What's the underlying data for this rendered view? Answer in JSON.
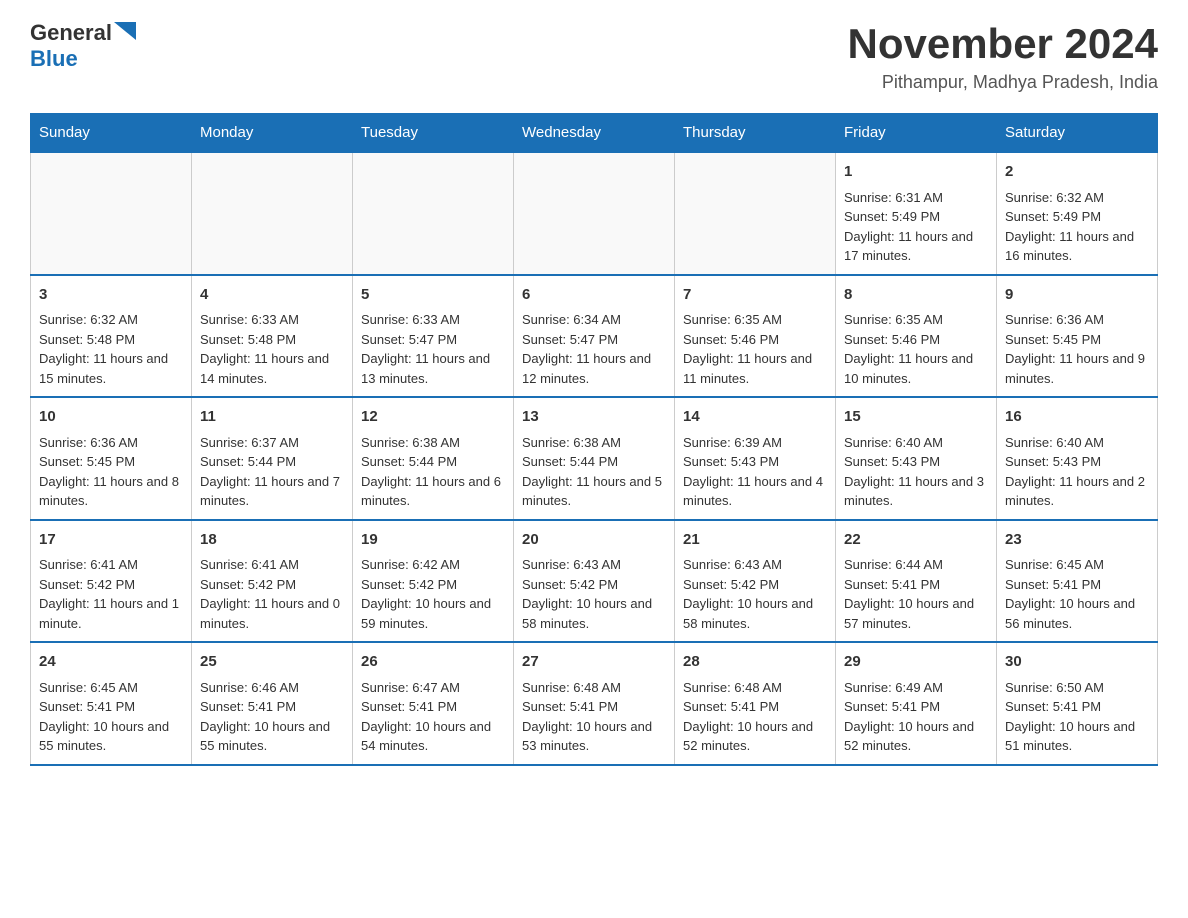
{
  "header": {
    "logo": {
      "general": "General",
      "blue": "Blue"
    },
    "title": "November 2024",
    "location": "Pithampur, Madhya Pradesh, India"
  },
  "days_of_week": [
    "Sunday",
    "Monday",
    "Tuesday",
    "Wednesday",
    "Thursday",
    "Friday",
    "Saturday"
  ],
  "weeks": [
    {
      "days": [
        {
          "number": "",
          "info": ""
        },
        {
          "number": "",
          "info": ""
        },
        {
          "number": "",
          "info": ""
        },
        {
          "number": "",
          "info": ""
        },
        {
          "number": "",
          "info": ""
        },
        {
          "number": "1",
          "info": "Sunrise: 6:31 AM\nSunset: 5:49 PM\nDaylight: 11 hours and 17 minutes."
        },
        {
          "number": "2",
          "info": "Sunrise: 6:32 AM\nSunset: 5:49 PM\nDaylight: 11 hours and 16 minutes."
        }
      ]
    },
    {
      "days": [
        {
          "number": "3",
          "info": "Sunrise: 6:32 AM\nSunset: 5:48 PM\nDaylight: 11 hours and 15 minutes."
        },
        {
          "number": "4",
          "info": "Sunrise: 6:33 AM\nSunset: 5:48 PM\nDaylight: 11 hours and 14 minutes."
        },
        {
          "number": "5",
          "info": "Sunrise: 6:33 AM\nSunset: 5:47 PM\nDaylight: 11 hours and 13 minutes."
        },
        {
          "number": "6",
          "info": "Sunrise: 6:34 AM\nSunset: 5:47 PM\nDaylight: 11 hours and 12 minutes."
        },
        {
          "number": "7",
          "info": "Sunrise: 6:35 AM\nSunset: 5:46 PM\nDaylight: 11 hours and 11 minutes."
        },
        {
          "number": "8",
          "info": "Sunrise: 6:35 AM\nSunset: 5:46 PM\nDaylight: 11 hours and 10 minutes."
        },
        {
          "number": "9",
          "info": "Sunrise: 6:36 AM\nSunset: 5:45 PM\nDaylight: 11 hours and 9 minutes."
        }
      ]
    },
    {
      "days": [
        {
          "number": "10",
          "info": "Sunrise: 6:36 AM\nSunset: 5:45 PM\nDaylight: 11 hours and 8 minutes."
        },
        {
          "number": "11",
          "info": "Sunrise: 6:37 AM\nSunset: 5:44 PM\nDaylight: 11 hours and 7 minutes."
        },
        {
          "number": "12",
          "info": "Sunrise: 6:38 AM\nSunset: 5:44 PM\nDaylight: 11 hours and 6 minutes."
        },
        {
          "number": "13",
          "info": "Sunrise: 6:38 AM\nSunset: 5:44 PM\nDaylight: 11 hours and 5 minutes."
        },
        {
          "number": "14",
          "info": "Sunrise: 6:39 AM\nSunset: 5:43 PM\nDaylight: 11 hours and 4 minutes."
        },
        {
          "number": "15",
          "info": "Sunrise: 6:40 AM\nSunset: 5:43 PM\nDaylight: 11 hours and 3 minutes."
        },
        {
          "number": "16",
          "info": "Sunrise: 6:40 AM\nSunset: 5:43 PM\nDaylight: 11 hours and 2 minutes."
        }
      ]
    },
    {
      "days": [
        {
          "number": "17",
          "info": "Sunrise: 6:41 AM\nSunset: 5:42 PM\nDaylight: 11 hours and 1 minute."
        },
        {
          "number": "18",
          "info": "Sunrise: 6:41 AM\nSunset: 5:42 PM\nDaylight: 11 hours and 0 minutes."
        },
        {
          "number": "19",
          "info": "Sunrise: 6:42 AM\nSunset: 5:42 PM\nDaylight: 10 hours and 59 minutes."
        },
        {
          "number": "20",
          "info": "Sunrise: 6:43 AM\nSunset: 5:42 PM\nDaylight: 10 hours and 58 minutes."
        },
        {
          "number": "21",
          "info": "Sunrise: 6:43 AM\nSunset: 5:42 PM\nDaylight: 10 hours and 58 minutes."
        },
        {
          "number": "22",
          "info": "Sunrise: 6:44 AM\nSunset: 5:41 PM\nDaylight: 10 hours and 57 minutes."
        },
        {
          "number": "23",
          "info": "Sunrise: 6:45 AM\nSunset: 5:41 PM\nDaylight: 10 hours and 56 minutes."
        }
      ]
    },
    {
      "days": [
        {
          "number": "24",
          "info": "Sunrise: 6:45 AM\nSunset: 5:41 PM\nDaylight: 10 hours and 55 minutes."
        },
        {
          "number": "25",
          "info": "Sunrise: 6:46 AM\nSunset: 5:41 PM\nDaylight: 10 hours and 55 minutes."
        },
        {
          "number": "26",
          "info": "Sunrise: 6:47 AM\nSunset: 5:41 PM\nDaylight: 10 hours and 54 minutes."
        },
        {
          "number": "27",
          "info": "Sunrise: 6:48 AM\nSunset: 5:41 PM\nDaylight: 10 hours and 53 minutes."
        },
        {
          "number": "28",
          "info": "Sunrise: 6:48 AM\nSunset: 5:41 PM\nDaylight: 10 hours and 52 minutes."
        },
        {
          "number": "29",
          "info": "Sunrise: 6:49 AM\nSunset: 5:41 PM\nDaylight: 10 hours and 52 minutes."
        },
        {
          "number": "30",
          "info": "Sunrise: 6:50 AM\nSunset: 5:41 PM\nDaylight: 10 hours and 51 minutes."
        }
      ]
    }
  ]
}
